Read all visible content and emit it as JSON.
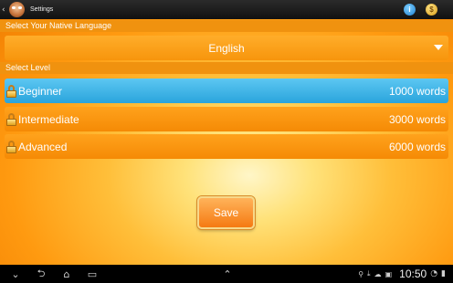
{
  "actionbar": {
    "title": "Settings",
    "info_label": "i",
    "coin_label": "$"
  },
  "language": {
    "section_label": "Select Your Native Language",
    "selected": "English"
  },
  "level": {
    "section_label": "Select Level",
    "items": [
      {
        "name": "Beginner",
        "count": "1000 words",
        "selected": true
      },
      {
        "name": "Intermediate",
        "count": "3000 words",
        "selected": false
      },
      {
        "name": "Advanced",
        "count": "6000 words",
        "selected": false
      }
    ]
  },
  "save_label": "Save",
  "status": {
    "time": "10:50"
  },
  "colors": {
    "orange": "#f7950c",
    "selected_blue": "#2aa4dc"
  }
}
